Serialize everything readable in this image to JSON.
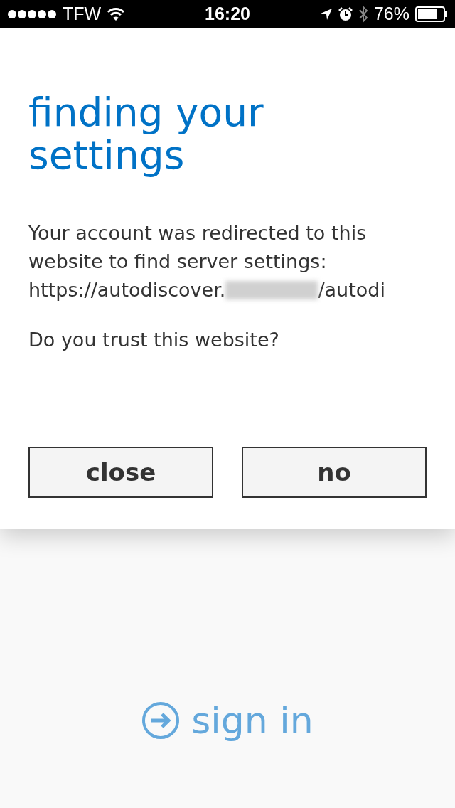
{
  "status_bar": {
    "carrier": "TFW",
    "time": "16:20",
    "battery": "76%"
  },
  "dialog": {
    "title": "finding your settings",
    "message": "Your account was redirected to this website to find server settings:",
    "url_start": "https://autodiscover.",
    "url_end": "/autodi",
    "question": "Do you trust this website?",
    "buttons": [
      "close",
      "no"
    ]
  },
  "sign_in": {
    "label": "sign in"
  }
}
